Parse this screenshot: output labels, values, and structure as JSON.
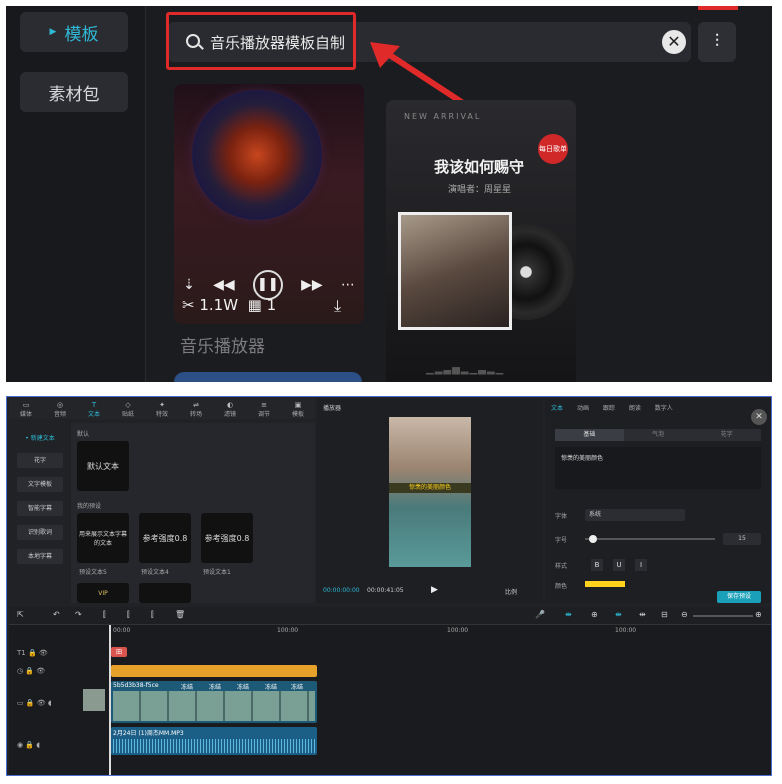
{
  "template_panel": {
    "sidebar": [
      {
        "label": "模板",
        "active": true
      },
      {
        "label": "素材包",
        "active": false
      }
    ],
    "search": {
      "value": "音乐播放器模板自制",
      "clear_glyph": "✕",
      "filter_glyph": "⫶"
    },
    "cards": [
      {
        "title": "音乐播放器",
        "stats": "1.1W",
        "clips": "1",
        "scissors_glyph": "✂",
        "clips_glyph": "▦",
        "download_glyph": "⤓",
        "controls": [
          "⇣",
          "◀◀",
          "❚❚",
          "▶▶",
          "⋯"
        ]
      },
      {
        "english": "NEW ARRIVAL",
        "heading": "我该如何赐守",
        "subtitle": "演唱者：周星星",
        "badge": "每日歌单",
        "wave": "▁▂▃▅▂▁▃▂▁"
      }
    ],
    "accent_color": "#2fb9d6",
    "highlight_color": "#e02a2a"
  },
  "editor": {
    "toolbar": [
      {
        "label": "媒体",
        "glyph": "▭"
      },
      {
        "label": "音频",
        "glyph": "◎"
      },
      {
        "label": "文本",
        "glyph": "T",
        "active": true
      },
      {
        "label": "贴纸",
        "glyph": "◇"
      },
      {
        "label": "特效",
        "glyph": "✦"
      },
      {
        "label": "转场",
        "glyph": "⇌"
      },
      {
        "label": "滤镜",
        "glyph": "◐"
      },
      {
        "label": "调节",
        "glyph": "≡"
      },
      {
        "label": "模板",
        "glyph": "▣"
      }
    ],
    "text_sidebar": [
      {
        "label": "• 新建文本",
        "active": true
      },
      {
        "label": "花字"
      },
      {
        "label": "文字模板"
      },
      {
        "label": "智能字幕"
      },
      {
        "label": "识别歌词"
      },
      {
        "label": "本地字幕"
      }
    ],
    "text_presets": {
      "default_label": "默认",
      "default_card": "默认文本",
      "my_presets_label": "我的预设",
      "cards": [
        {
          "text": "用来展示文本字幕的文本",
          "caption": "预设文本5"
        },
        {
          "text": "参考强度0.8",
          "caption": "预设文本4"
        },
        {
          "text": "参考强度0.8",
          "caption": "预设文本1"
        }
      ],
      "vip": "VIP"
    },
    "player": {
      "title": "播放器",
      "caption": "惊羡的美丽颜色",
      "time_current": "00:00:00:00",
      "time_total": "00:00:41:05",
      "play_glyph": "▶",
      "ratio": "比例"
    },
    "props": {
      "tabs": [
        "文本",
        "动画",
        "跟踪",
        "朗读",
        "数字人"
      ],
      "subtabs": [
        "基础",
        "气泡",
        "花字"
      ],
      "content": "惊羡的美丽颜色",
      "font_label": "字体",
      "font_value": "系统",
      "size_label": "字号",
      "size_value": "15",
      "style_label": "样式",
      "style_buttons": [
        "B",
        "U",
        "I"
      ],
      "color_label": "颜色",
      "preset_button": "保存预设",
      "close_glyph": "✕"
    },
    "timeline": {
      "ticks": [
        "00:00",
        "100:00",
        "100:00",
        "100:00"
      ],
      "video_label": "5b5d3b38-f5ce",
      "audio_label": "2月24日 (1)周杰MM.MP3",
      "tags": [
        "冻结",
        "冻结",
        "冻结",
        "冻结",
        "冻结"
      ],
      "text_clip": "田",
      "toolbar_left": [
        "⇱",
        "↶",
        "↷",
        "⫿",
        "⫿",
        "⫿",
        "🗑"
      ],
      "toolbar_right": [
        "🎤",
        "⇼",
        "⊕",
        "⇼",
        "⇹",
        "⊟",
        "⊖",
        "⊕"
      ]
    }
  }
}
